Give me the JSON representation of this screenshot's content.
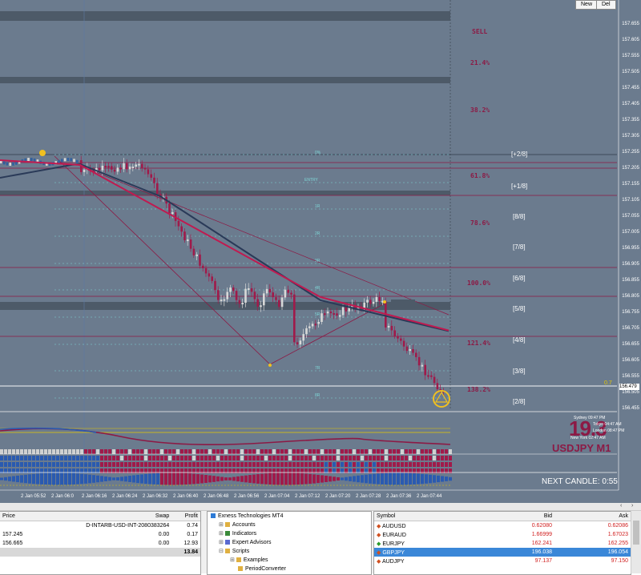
{
  "toolbar": {
    "new_label": "New",
    "del_label": "Del"
  },
  "chart": {
    "signal": "SELL",
    "fib_levels": [
      "21.4%",
      "38.2%",
      "61.8%",
      "78.6%",
      "100.0%",
      "121.4%",
      "138.2%"
    ],
    "murrey_levels": [
      "[+2/8]",
      "[+1/8]",
      "[8/8]",
      "[7/8]",
      "[6/8]",
      "[5/8]",
      "[4/8]",
      "[3/8]",
      "[2/8]"
    ],
    "inner_labels": [
      "0%",
      "ENTRY",
      "1R",
      "2R",
      "3R",
      "4R",
      "5R",
      "7R",
      "8R"
    ],
    "price_axis": [
      "157.655",
      "157.605",
      "157.555",
      "157.505",
      "157.455",
      "157.405",
      "157.355",
      "157.305",
      "157.255",
      "157.205",
      "157.155",
      "157.105",
      "157.055",
      "157.005",
      "156.955",
      "156.905",
      "156.855",
      "156.805",
      "156.755",
      "156.705",
      "156.655",
      "156.605",
      "156.555",
      "156.505",
      "156.455"
    ],
    "current_price": "156.479",
    "level_label": "0.7",
    "counter": "19.3",
    "symbol_label": "USDJPY M1",
    "sessions": [
      "Sydney  09:47 PM",
      "Tokyo  04:47 AM",
      "London  08:47 PM",
      "New York  02:47 AM"
    ],
    "next_candle": "NEXT CANDLE: 0:55",
    "time_labels": [
      "2 Jan 05:52",
      "2 Jan 06:0",
      "2 Jan 06:16",
      "2 Jan 06:24",
      "2 Jan 06:32",
      "2 Jan 06:40",
      "2 Jan 06:48",
      "2 Jan 06:56",
      "2 Jan 07:04",
      "2 Jan 07:12",
      "2 Jan 07:20",
      "2 Jan 07:28",
      "2 Jan 07:36",
      "2 Jan 07:44"
    ],
    "colors": {
      "background": "#6b7b8e",
      "bear": "#a01a4a",
      "bull": "#d8d8d8",
      "ma": "#c01a50",
      "fib_text": "#8c1a45"
    }
  },
  "trade": {
    "headers": [
      "Price",
      "Swap",
      "Profit"
    ],
    "rows": [
      {
        "price": "",
        "swap": "D-INTARB-USD-INT-2080383264",
        "profit": "0.74"
      },
      {
        "price": "157.245",
        "swap": "0.00",
        "profit": "0.17"
      },
      {
        "price": "156.665",
        "swap": "0.00",
        "profit": "12.93"
      }
    ],
    "total": "13.84"
  },
  "navigator": {
    "root": "Exness Technologies MT4",
    "items": [
      "Accounts",
      "Indicators",
      "Expert Advisors",
      "Scripts",
      "Examples",
      "PeriodConverter"
    ]
  },
  "market_watch": {
    "headers": [
      "Symbol",
      "Bid",
      "Ask"
    ],
    "rows": [
      {
        "symbol": "AUDUSD",
        "bid": "0.62080",
        "ask": "0.62086",
        "dir": "down"
      },
      {
        "symbol": "EURAUD",
        "bid": "1.66999",
        "ask": "1.67023",
        "dir": "down"
      },
      {
        "symbol": "EURJPY",
        "bid": "162.241",
        "ask": "162.255",
        "dir": "up"
      },
      {
        "symbol": "GBPJPY",
        "bid": "196.038",
        "ask": "196.054",
        "dir": "down",
        "selected": true
      },
      {
        "symbol": "AUDJPY",
        "bid": "97.137",
        "ask": "97.150",
        "dir": "down"
      }
    ]
  }
}
